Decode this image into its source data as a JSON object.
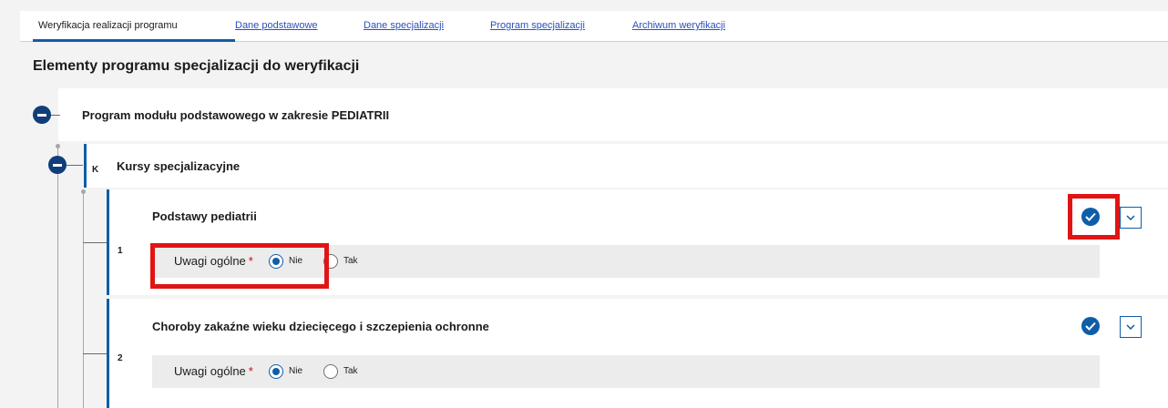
{
  "tabs": [
    {
      "label": "Weryfikacja realizacji programu"
    },
    {
      "label": "Dane podstawowe"
    },
    {
      "label": "Dane specjalizacji"
    },
    {
      "label": "Program specjalizacji"
    },
    {
      "label": "Archiwum weryfikacji"
    }
  ],
  "page_title": "Elementy programu specjalizacji do weryfikacji",
  "module": {
    "title": "Program modułu podstawowego w zakresie PEDIATRII"
  },
  "group": {
    "letter": "K",
    "title": "Kursy specjalizacyjne"
  },
  "items": [
    {
      "number": "1",
      "title": "Podstawy pediatrii",
      "remarks_label": "Uwagi ogólne",
      "required_mark": "*",
      "option_no": "Nie",
      "option_yes": "Tak"
    },
    {
      "number": "2",
      "title": "Choroby zakaźne wieku dziecięcego i szczepienia ochronne",
      "remarks_label": "Uwagi ogólne",
      "required_mark": "*",
      "option_no": "Nie",
      "option_yes": "Tak"
    }
  ],
  "colors": {
    "accent": "#0f5da8",
    "highlight": "#e11414",
    "required": "#d0021b"
  }
}
